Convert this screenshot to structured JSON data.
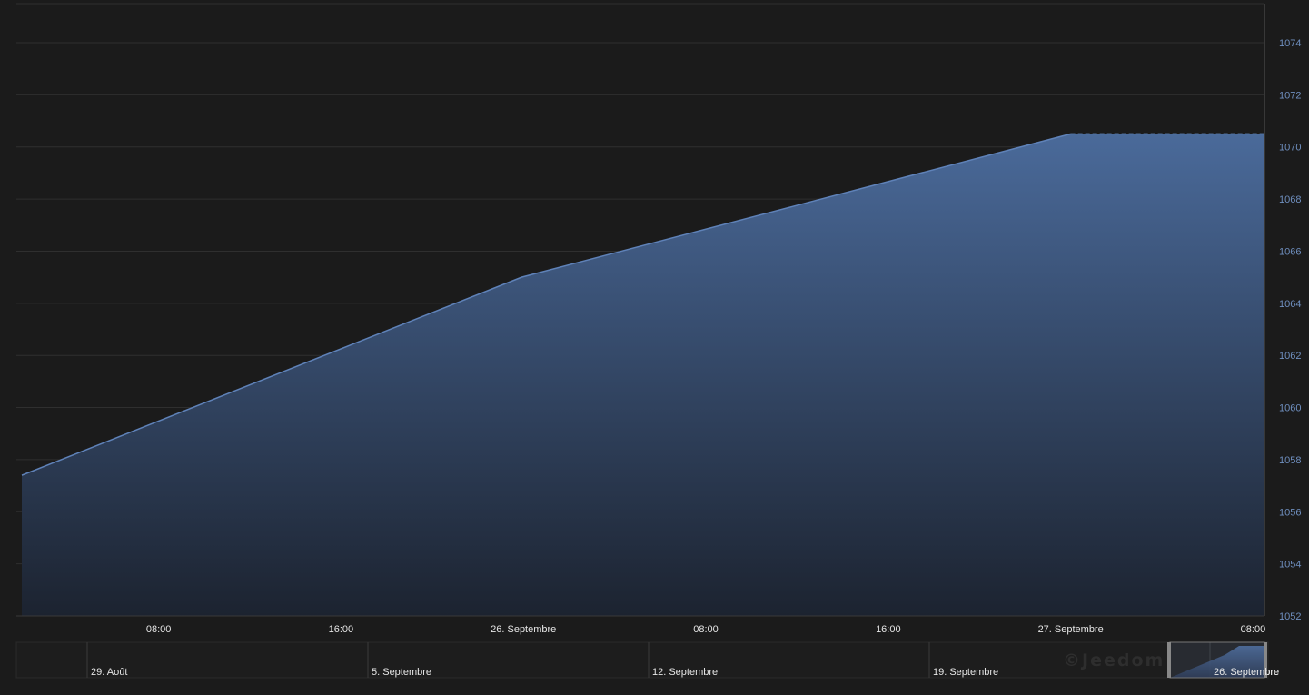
{
  "watermark": "©Jeedom",
  "colors": {
    "background": "#1b1b1b",
    "grid": "#2f2f2f",
    "series_line": "#5f82b8",
    "area_top": "#4a6a9a",
    "area_bottom": "#1c2330",
    "y_tick": "#6f8fbf",
    "x_tick": "#e6e6e6"
  },
  "chart_data": [
    {
      "type": "area",
      "title": "",
      "xlabel": "",
      "ylabel": "",
      "y_axis_side": "right",
      "ylim": [
        1052,
        1075.5
      ],
      "y_ticks": [
        1052,
        1054,
        1056,
        1058,
        1060,
        1062,
        1064,
        1066,
        1068,
        1070,
        1072,
        1074
      ],
      "x_range": [
        "25 Sep 02:00",
        "27 Sep 08:30"
      ],
      "x_ticks": [
        {
          "label": "08:00",
          "at": "25 Sep 08:00"
        },
        {
          "label": "16:00",
          "at": "25 Sep 16:00"
        },
        {
          "label": "26. Septembre",
          "at": "26 Sep 00:00"
        },
        {
          "label": "08:00",
          "at": "26 Sep 08:00"
        },
        {
          "label": "16:00",
          "at": "26 Sep 16:00"
        },
        {
          "label": "27. Septembre",
          "at": "27 Sep 00:00"
        },
        {
          "label": "08:00",
          "at": "27 Sep 08:00"
        }
      ],
      "grid": true,
      "series": [
        {
          "points": [
            {
              "x": "25 Sep 02:00",
              "y": 1057.4
            },
            {
              "x": "25 Sep 23:55",
              "y": 1065.0
            },
            {
              "x": "27 Sep 00:00",
              "y": 1070.5
            }
          ],
          "projection": {
            "x_from": "27 Sep 00:00",
            "x_to": "27 Sep 08:30",
            "y": 1070.5,
            "style": "dashed"
          }
        }
      ]
    },
    {
      "type": "area",
      "role": "navigator",
      "x_ticks": [
        "29. Août",
        "5. Septembre",
        "12. Septembre",
        "19. Septembre",
        "26. Septembre"
      ],
      "selected_range": [
        "25 Sep",
        "27 Sep"
      ]
    }
  ]
}
